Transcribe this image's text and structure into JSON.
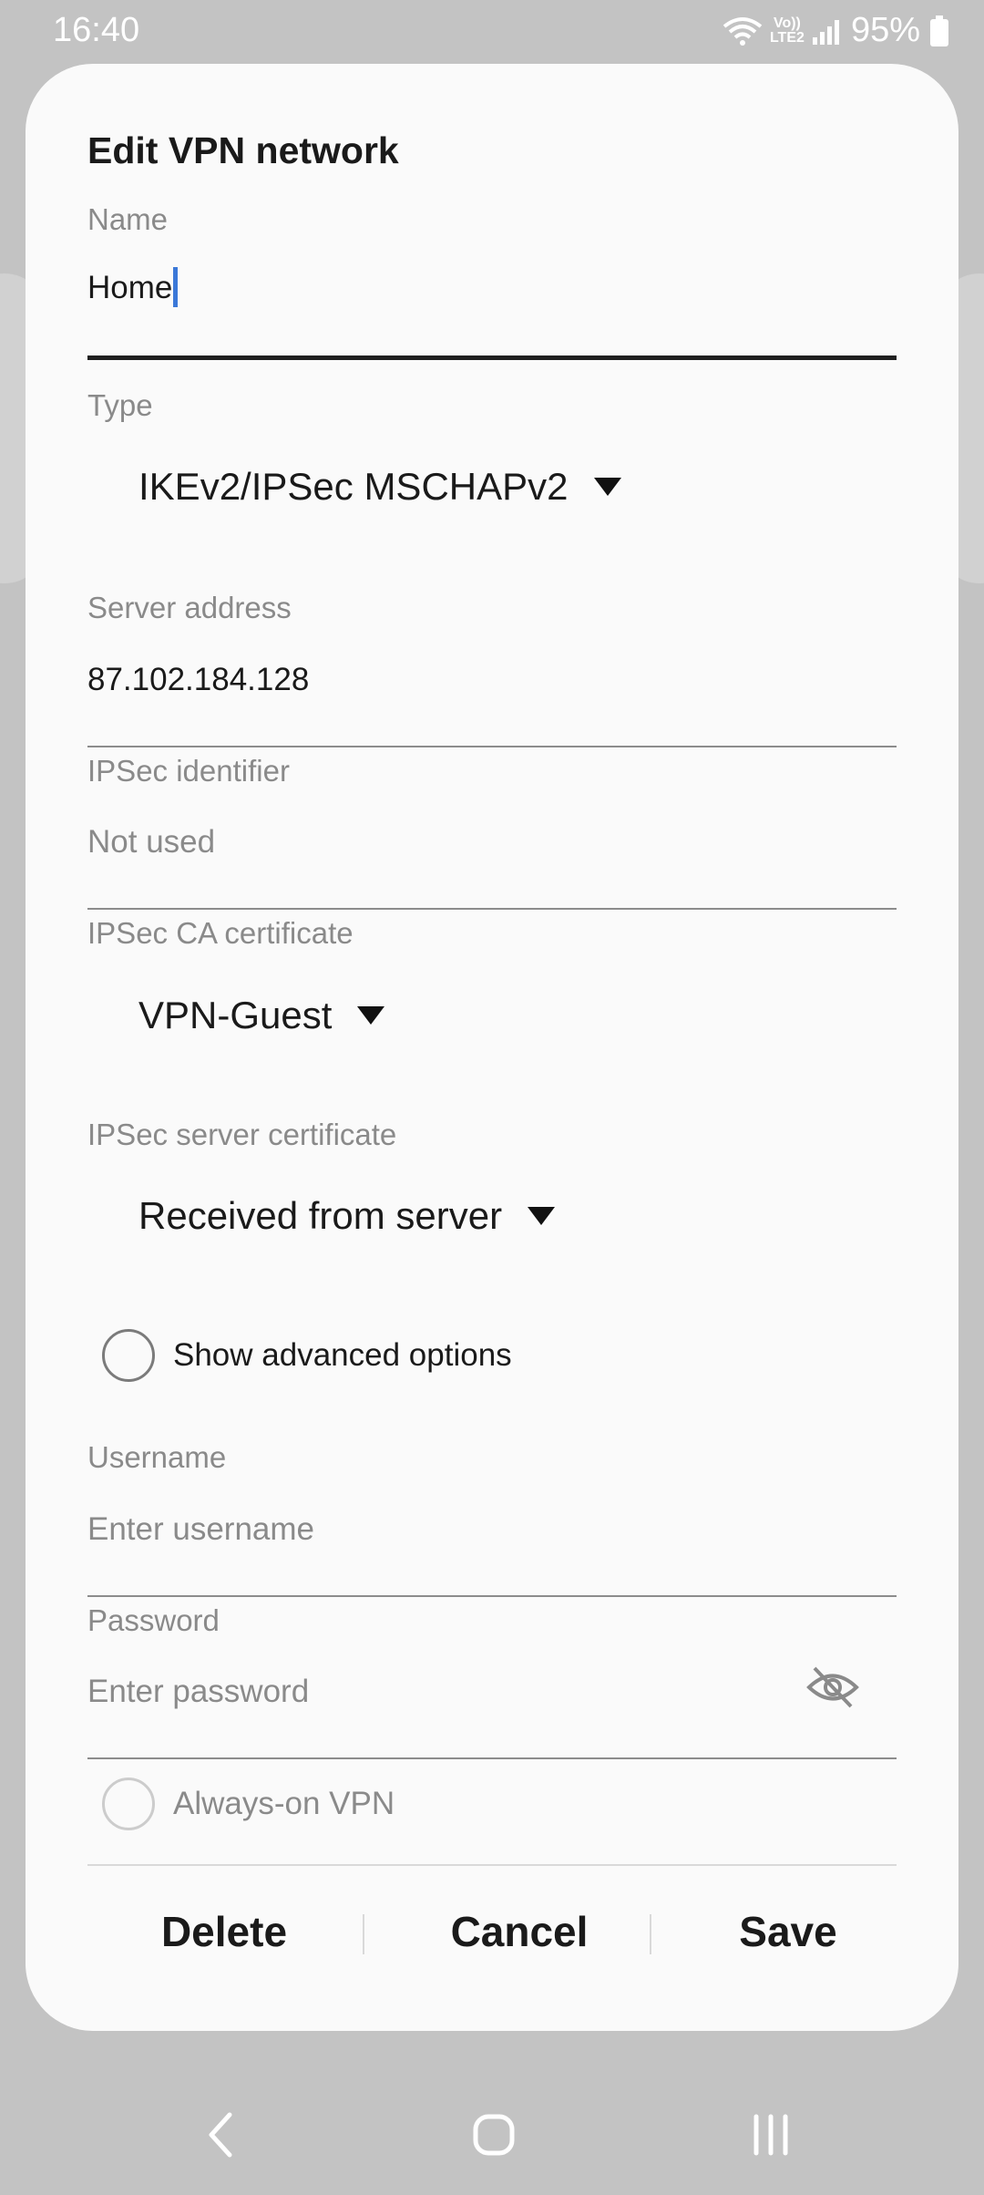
{
  "status_bar": {
    "time": "16:40",
    "network_label": "Vo)) LTE2",
    "battery_percent": "95%"
  },
  "dialog": {
    "title": "Edit VPN network",
    "name": {
      "label": "Name",
      "value": "Home"
    },
    "type": {
      "label": "Type",
      "value": "IKEv2/IPSec MSCHAPv2"
    },
    "server_address": {
      "label": "Server address",
      "value": "87.102.184.128"
    },
    "ipsec_identifier": {
      "label": "IPSec identifier",
      "placeholder": "Not used"
    },
    "ipsec_ca_certificate": {
      "label": "IPSec CA certificate",
      "value": "VPN-Guest"
    },
    "ipsec_server_certificate": {
      "label": "IPSec server certificate",
      "value": "Received from server"
    },
    "advanced_options": {
      "label": "Show advanced options",
      "checked": false
    },
    "username": {
      "label": "Username",
      "placeholder": "Enter username"
    },
    "password": {
      "label": "Password",
      "placeholder": "Enter password"
    },
    "always_on": {
      "label": "Always-on VPN",
      "checked": false,
      "disabled": true
    },
    "buttons": {
      "delete": "Delete",
      "cancel": "Cancel",
      "save": "Save"
    }
  },
  "colors": {
    "accent_cursor": "#3b78d8",
    "dialog_bg": "#fafafa",
    "screen_bg": "#c3c3c3"
  },
  "icons": [
    "wifi-icon",
    "signal-icon",
    "battery-icon",
    "dropdown-caret-icon",
    "eye-off-icon",
    "back-icon",
    "home-icon",
    "recents-icon"
  ]
}
